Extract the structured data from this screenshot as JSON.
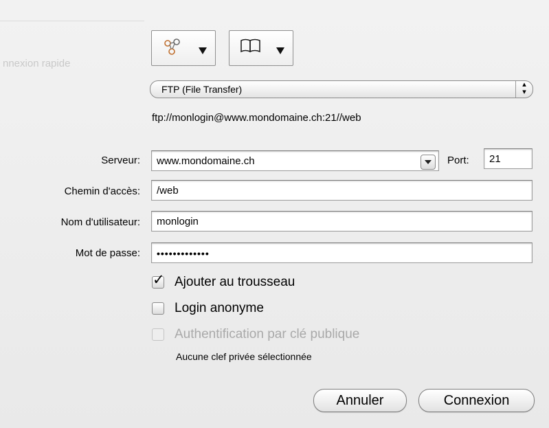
{
  "background_hint": {
    "ghost_label": "nnexion rapide"
  },
  "toolbar": {
    "bookmark_popup_icon": "bookmark-network-icon",
    "book_popup_icon": "book-icon"
  },
  "protocol": {
    "selected": "FTP (File Transfer)"
  },
  "url_preview": "ftp://monlogin@www.mondomaine.ch:21//web",
  "form": {
    "server_label": "Serveur:",
    "server_value": "www.mondomaine.ch",
    "port_label": "Port:",
    "port_value": "21",
    "path_label": "Chemin d'accès:",
    "path_value": "/web",
    "user_label": "Nom d'utilisateur:",
    "user_value": "monlogin",
    "password_label": "Mot de passe:",
    "password_value": "•••••••••••••"
  },
  "options": {
    "keychain_label": "Ajouter au trousseau",
    "keychain_checked": true,
    "anonymous_label": "Login anonyme",
    "anonymous_checked": false,
    "pubkey_label": "Authentification par clé publique",
    "pubkey_enabled": false,
    "pubkey_note": "Aucune clef privée sélectionnée"
  },
  "buttons": {
    "cancel": "Annuler",
    "connect": "Connexion"
  }
}
